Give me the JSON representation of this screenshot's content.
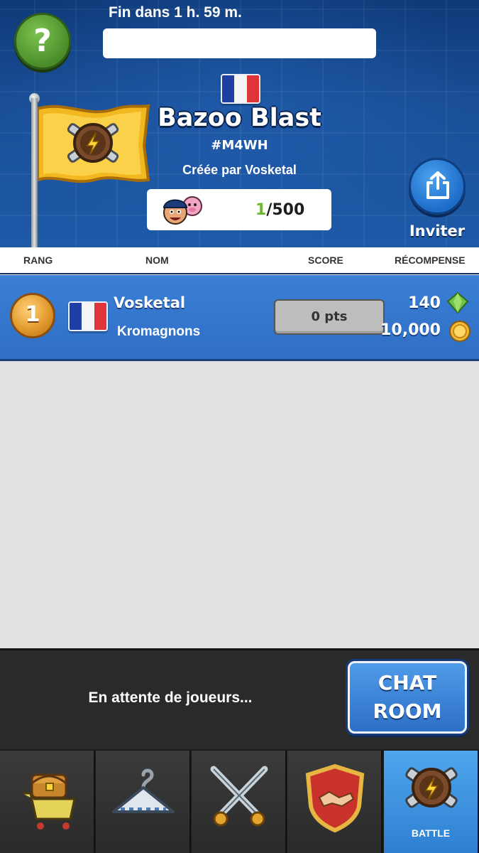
{
  "header": {
    "timer_text": "Fin dans 1 h. 59 m.",
    "help_label": "?",
    "team_name": "Bazoo Blast",
    "team_tag": "#M4WH",
    "created_by": "Créée par Vosketal",
    "members_current": "1",
    "members_max": "/500",
    "invite_label": "Inviter"
  },
  "columns": {
    "rank": "RANG",
    "name": "NOM",
    "score": "SCORE",
    "reward": "RÉCOMPENSE"
  },
  "rows": [
    {
      "rank": "1",
      "player": "Vosketal",
      "team": "Kromagnons",
      "score": "0 pts",
      "gems": "140",
      "coins": "10,000"
    }
  ],
  "footer": {
    "waiting_text": "En attente de joueurs...",
    "chat_line1": "CHAT",
    "chat_line2": "ROOM"
  },
  "tabs": [
    {
      "icon": "shop-cart-icon"
    },
    {
      "icon": "hanger-icon"
    },
    {
      "icon": "crossed-swords-icon"
    },
    {
      "icon": "handshake-shield-icon"
    },
    {
      "icon": "battle-emblem-icon",
      "label": "BATTLE",
      "active": true
    }
  ],
  "colors": {
    "header_blue": "#1a4f98",
    "row_blue": "#3a7fd6",
    "help_green": "#5fa43a",
    "score_green": "#6bb92a"
  }
}
